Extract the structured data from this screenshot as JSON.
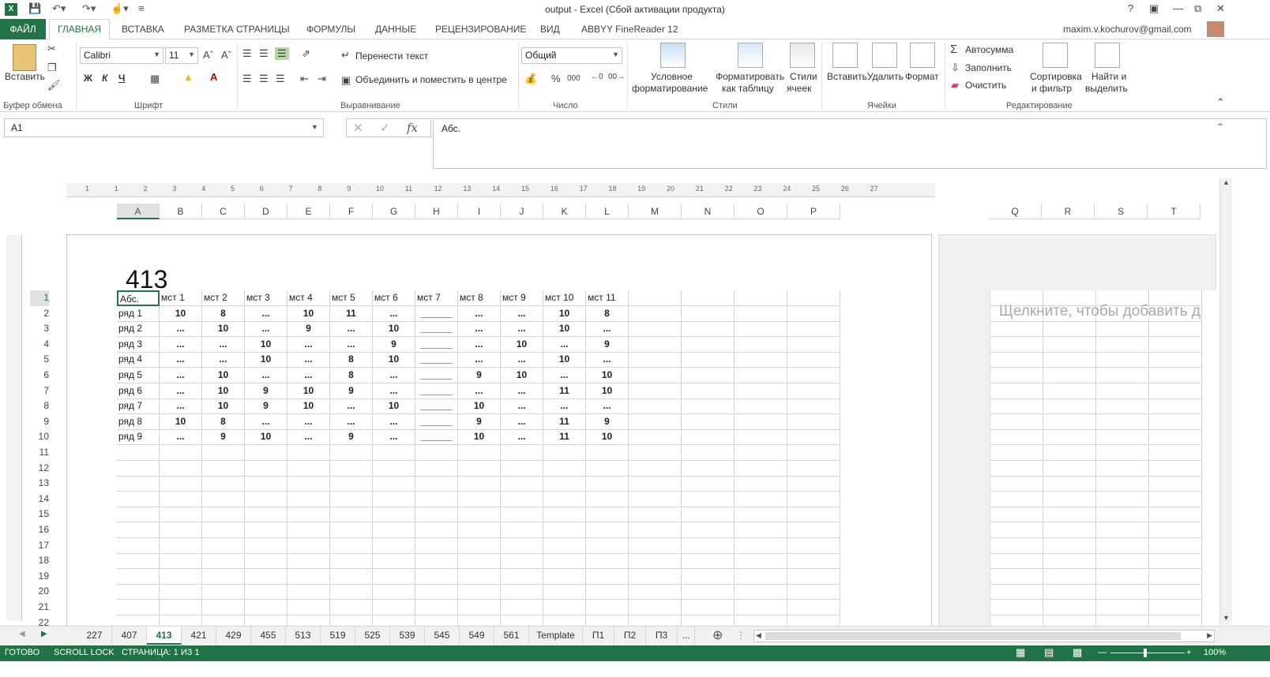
{
  "window": {
    "title": "output - Excel (Сбой активации продукта)",
    "help": "?",
    "account": "maxim.v.kochurov@gmail.com"
  },
  "tabs": {
    "file": "ФАЙЛ",
    "home": "ГЛАВНАЯ",
    "insert": "ВСТАВКА",
    "layout": "РАЗМЕТКА СТРАНИЦЫ",
    "formulas": "ФОРМУЛЫ",
    "data": "ДАННЫЕ",
    "review": "РЕЦЕНЗИРОВАНИЕ",
    "view": "ВИД",
    "abbyy": "ABBYY FineReader 12"
  },
  "ribbon": {
    "paste": "Вставить",
    "clipboard": "Буфер обмена",
    "font_name": "Calibri",
    "font_size": "11",
    "bold": "Ж",
    "italic": "К",
    "underline": "Ч",
    "font_group": "Шрифт",
    "wrap_text": "Перенести текст",
    "merge_center": "Объединить и поместить в центре",
    "alignment_group": "Выравнивание",
    "number_format": "Общий",
    "number_group": "Число",
    "cond_format_1": "Условное",
    "cond_format_2": "форматирование",
    "format_table_1": "Форматировать",
    "format_table_2": "как таблицу",
    "cell_styles_1": "Стили",
    "cell_styles_2": "ячеек",
    "styles_group": "Стили",
    "insert_cells": "Вставить",
    "delete_cells": "Удалить",
    "format_cells": "Формат",
    "cells_group": "Ячейки",
    "autosum": "Автосумма",
    "fill": "Заполнить",
    "clear": "Очистить",
    "sort_1": "Сортировка",
    "sort_2": "и фильтр",
    "find_1": "Найти и",
    "find_2": "выделить",
    "editing_group": "Редактирование"
  },
  "formula_bar": {
    "name_box": "A1",
    "content": "Абс."
  },
  "page_header_value": "413",
  "columns": [
    "A",
    "B",
    "C",
    "D",
    "E",
    "F",
    "G",
    "H",
    "I",
    "J",
    "K",
    "L",
    "M",
    "N",
    "O",
    "P"
  ],
  "right_columns": [
    "Q",
    "R",
    "S",
    "T"
  ],
  "ruler_ticks": [
    "1",
    "1",
    "2",
    "3",
    "4",
    "5",
    "6",
    "7",
    "8",
    "9",
    "10",
    "11",
    "12",
    "13",
    "14",
    "15",
    "16",
    "17",
    "18",
    "19",
    "20",
    "21",
    "22",
    "23",
    "24",
    "25",
    "26",
    "27"
  ],
  "table": {
    "header": [
      "Абс.",
      "мст 1",
      "мст 2",
      "мст 3",
      "мст 4",
      "мст 5",
      "мст 6",
      "мст 7",
      "мст 8",
      "мст 9",
      "мст 10",
      "мст 11"
    ],
    "rows": [
      [
        "ряд 1",
        "10",
        "8",
        "...",
        "10",
        "11",
        "...",
        "______",
        "...",
        "...",
        "10",
        "8"
      ],
      [
        "ряд 2",
        "...",
        "10",
        "...",
        "9",
        "...",
        "10",
        "______",
        "...",
        "...",
        "10",
        "..."
      ],
      [
        "ряд 3",
        "...",
        "...",
        "10",
        "...",
        "...",
        "9",
        "______",
        "...",
        "10",
        "...",
        "9"
      ],
      [
        "ряд 4",
        "...",
        "...",
        "10",
        "...",
        "8",
        "10",
        "______",
        "...",
        "...",
        "10",
        "..."
      ],
      [
        "ряд 5",
        "...",
        "10",
        "...",
        "...",
        "8",
        "...",
        "______",
        "9",
        "10",
        "...",
        "10"
      ],
      [
        "ряд 6",
        "...",
        "10",
        "9",
        "10",
        "9",
        "...",
        "______",
        "...",
        "...",
        "11",
        "10"
      ],
      [
        "ряд 7",
        "...",
        "10",
        "9",
        "10",
        "...",
        "10",
        "______",
        "10",
        "...",
        "...",
        "..."
      ],
      [
        "ряд 8",
        "10",
        "8",
        "...",
        "...",
        "...",
        "...",
        "______",
        "9",
        "...",
        "11",
        "9"
      ],
      [
        "ряд 9",
        "...",
        "9",
        "10",
        "...",
        "9",
        "...",
        "______",
        "10",
        "...",
        "11",
        "10"
      ]
    ]
  },
  "row_numbers": [
    "1",
    "2",
    "3",
    "4",
    "5",
    "6",
    "7",
    "8",
    "9",
    "10",
    "11",
    "12",
    "13",
    "14",
    "15",
    "16",
    "17",
    "18",
    "19",
    "20",
    "21",
    "22"
  ],
  "right_panel_hint": "Щелкните, чтобы добавить д",
  "sheet_tabs": [
    "227",
    "407",
    "413",
    "421",
    "429",
    "455",
    "513",
    "519",
    "525",
    "539",
    "545",
    "549",
    "561",
    "Template",
    "П1",
    "П2",
    "П3",
    "..."
  ],
  "active_sheet": "413",
  "status": {
    "ready": "ГОТОВО",
    "scroll_lock": "SCROLL LOCK",
    "page": "СТРАНИЦА: 1 ИЗ 1",
    "zoom": "100%"
  },
  "colors": {
    "accent": "#217346"
  }
}
